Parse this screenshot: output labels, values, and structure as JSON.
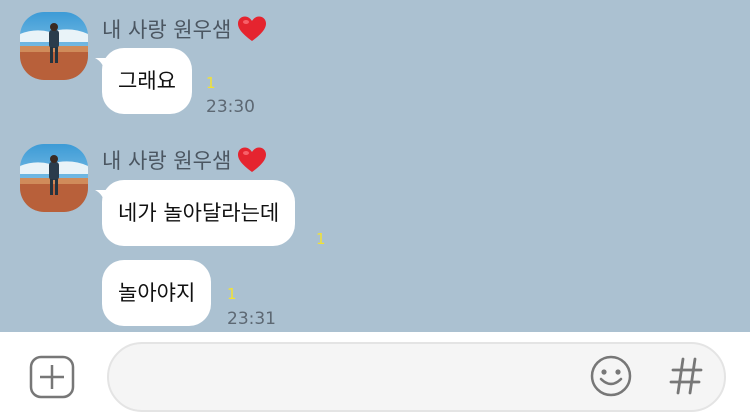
{
  "colors": {
    "chat_background": "#abc1d1",
    "bubble": "#ffffff",
    "unread": "#f2e234",
    "input_bar": "#ffffff"
  },
  "messages": [
    {
      "sender": "내 사랑 원우샘",
      "sender_icon": "heart-icon",
      "bubbles": [
        {
          "text": "그래요",
          "unread": "1",
          "time": "23:30"
        }
      ]
    },
    {
      "sender": "내 사랑 원우샘",
      "sender_icon": "heart-icon",
      "bubbles": [
        {
          "text": "네가 놀아달라는데",
          "unread": "1",
          "time": ""
        },
        {
          "text": "놀아야지",
          "unread": "1",
          "time": "23:31"
        }
      ]
    }
  ],
  "input_bar": {
    "placeholder": "",
    "icons": [
      "plus-square-icon",
      "emoji-icon",
      "hash-icon"
    ]
  }
}
